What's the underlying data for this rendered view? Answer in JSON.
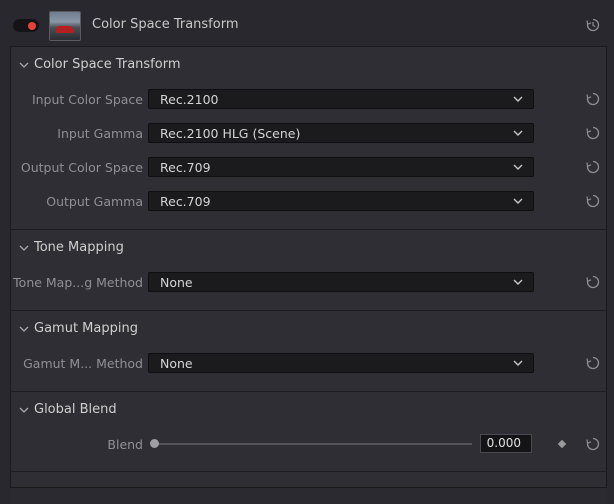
{
  "header": {
    "title": "Color Space Transform",
    "toggle_state": "on"
  },
  "sections": {
    "csc": {
      "title": "Color Space Transform"
    },
    "tone": {
      "title": "Tone Mapping"
    },
    "gamut": {
      "title": "Gamut Mapping"
    },
    "blend": {
      "title": "Global Blend"
    }
  },
  "fields": {
    "input_color_space": {
      "label": "Input Color Space",
      "value": "Rec.2100"
    },
    "input_gamma": {
      "label": "Input Gamma",
      "value": "Rec.2100 HLG (Scene)"
    },
    "output_color_space": {
      "label": "Output Color Space",
      "value": "Rec.709"
    },
    "output_gamma": {
      "label": "Output Gamma",
      "value": "Rec.709"
    },
    "tone_method": {
      "label": "Tone Map...g Method",
      "value": "None"
    },
    "gamut_method": {
      "label": "Gamut M... Method",
      "value": "None"
    },
    "blend": {
      "label": "Blend",
      "value": "0.000",
      "fraction": 0.0
    }
  },
  "colors": {
    "background": "#28282e",
    "panel": "#2e2e34",
    "toggle_on": "#e5403a"
  },
  "icons": [
    "reset-icon",
    "chevron-down-icon",
    "keyframe-diamond-icon"
  ]
}
